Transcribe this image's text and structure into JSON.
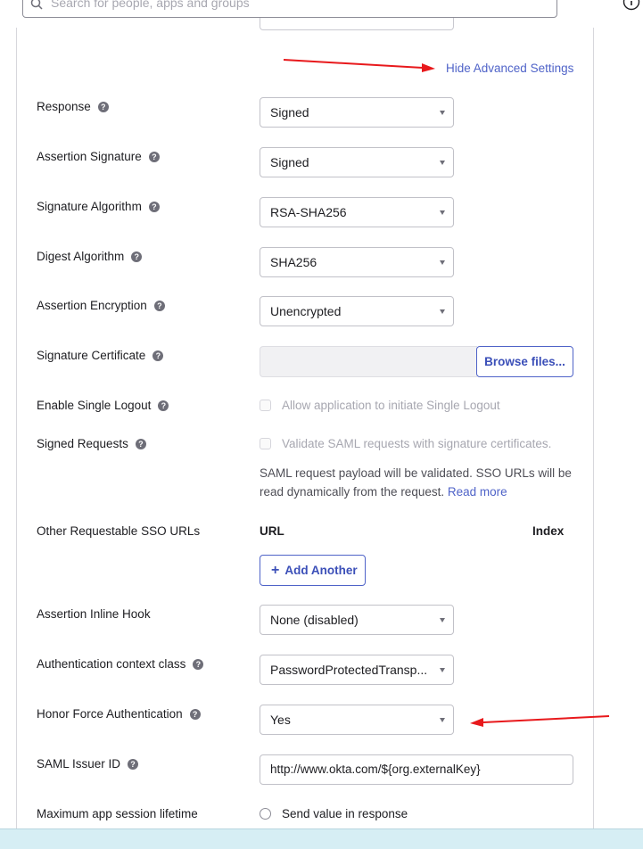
{
  "search": {
    "placeholder": "Search for people, apps and groups"
  },
  "advanced": {
    "toggle_label": "Hide Advanced Settings"
  },
  "fields": {
    "response": {
      "label": "Response",
      "value": "Signed"
    },
    "assertion_signature": {
      "label": "Assertion Signature",
      "value": "Signed"
    },
    "signature_algorithm": {
      "label": "Signature Algorithm",
      "value": "RSA-SHA256"
    },
    "digest_algorithm": {
      "label": "Digest Algorithm",
      "value": "SHA256"
    },
    "assertion_encryption": {
      "label": "Assertion Encryption",
      "value": "Unencrypted"
    },
    "signature_certificate": {
      "label": "Signature Certificate",
      "button": "Browse files..."
    },
    "single_logout": {
      "label": "Enable Single Logout",
      "checkbox": "Allow application to initiate Single Logout"
    },
    "signed_requests": {
      "label": "Signed Requests",
      "checkbox": "Validate SAML requests with signature certificates.",
      "help": "SAML request payload will be validated. SSO URLs will be read dynamically from the request.",
      "help_link": "Read more"
    },
    "other_sso_urls": {
      "label": "Other Requestable SSO URLs",
      "col_url": "URL",
      "col_index": "Index",
      "add_button": "Add Another"
    },
    "assertion_inline_hook": {
      "label": "Assertion Inline Hook",
      "value": "None (disabled)"
    },
    "auth_context_class": {
      "label": "Authentication context class",
      "value": "PasswordProtectedTransp..."
    },
    "honor_force_auth": {
      "label": "Honor Force Authentication",
      "value": "Yes"
    },
    "saml_issuer_id": {
      "label": "SAML Issuer ID",
      "value": "http://www.okta.com/${org.externalKey}"
    },
    "max_session_lifetime": {
      "label": "Maximum app session lifetime",
      "checkbox": "Send value in response"
    }
  },
  "colors": {
    "link": "#4f63c8",
    "annotation_arrow": "#e8191c"
  },
  "icons": {
    "search": "search-icon",
    "help": "help-circle-icon",
    "question": "question-icon",
    "caret": "chevron-down-icon"
  }
}
